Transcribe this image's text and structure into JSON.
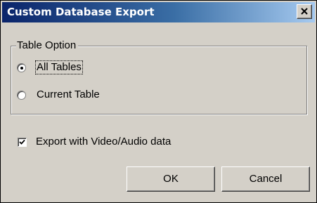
{
  "window": {
    "title": "Custom Database Export"
  },
  "table_option": {
    "legend": "Table Option",
    "options": [
      {
        "label": "All Tables",
        "selected": true
      },
      {
        "label": "Current Table",
        "selected": false
      }
    ]
  },
  "export_media": {
    "label": "Export with Video/Audio data",
    "checked": true
  },
  "buttons": {
    "ok": "OK",
    "cancel": "Cancel"
  },
  "icons": {
    "close": "close-icon",
    "check": "checkmark-icon",
    "radio_dot": "radio-dot"
  },
  "colors": {
    "dialog_face": "#d4d0c8",
    "titlebar_start": "#0a246a",
    "titlebar_end": "#a6caf0",
    "title_text": "#ffffff"
  }
}
